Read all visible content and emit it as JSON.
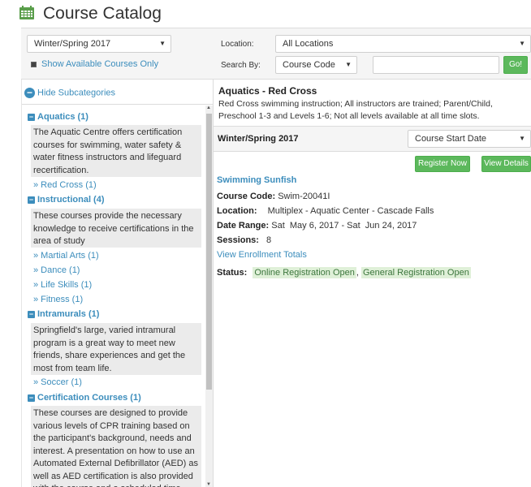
{
  "header": {
    "title": "Course Catalog",
    "icon": "calendar-icon"
  },
  "filters": {
    "term": "Winter/Spring 2017",
    "location_label": "Location:",
    "location_value": "All Locations",
    "show_available_label": "Show Available Courses Only",
    "show_available_checked": true,
    "search_by_label": "Search By:",
    "search_by_value": "Course Code",
    "search_text": "",
    "go_label": "Go!"
  },
  "sidebar": {
    "hide_sub_label": "Hide Subcategories",
    "categories": [
      {
        "head": "Aquatics (1)",
        "desc": "The Aquatic Centre offers certification courses for swimming, water safety & water fitness instructors and lifeguard recertification.",
        "subs": [
          "» Red Cross (1)"
        ]
      },
      {
        "head": "Instructional (4)",
        "desc": "These courses provide the necessary knowledge to receive certifications in the area of study",
        "subs": [
          "» Martial Arts (1)",
          "» Dance (1)",
          "» Life Skills (1)",
          "» Fitness (1)"
        ]
      },
      {
        "head": "Intramurals (1)",
        "desc": "Springfield's large, varied intramural program is a great way to meet new friends, share experiences and get the most from team life.",
        "subs": [
          "» Soccer (1)"
        ]
      },
      {
        "head": "Certification Courses (1)",
        "desc": "These courses are designed to provide various levels of CPR training based on the participant's background, needs and interest. A presentation on how to use an Automated External Defibrillator (AED) as well as AED certification is also provided with the course and a scheduled time with",
        "subs": []
      }
    ]
  },
  "main": {
    "category_title": "Aquatics - Red Cross",
    "category_desc": "Red Cross swimming instruction; All instructors are trained; Parent/Child, Preschool 1-3 and Levels 1-6; Not all levels available at all time slots.",
    "term": "Winter/Spring 2017",
    "sort_value": "Course Start Date",
    "register_label": "Register Now",
    "details_label": "View Details",
    "course": {
      "name": "Swimming Sunfish",
      "code_label": "Course Code:",
      "code": "Swim-20041I",
      "location_label": "Location:",
      "location": "Multiplex - Aquatic Center - Cascade Falls",
      "date_label": "Date Range:",
      "date": "Sat  May 6, 2017 - Sat  Jun 24, 2017",
      "sessions_label": "Sessions:",
      "sessions": "8",
      "enroll_link": "View Enrollment Totals",
      "status_label": "Status:",
      "status_1": "Online Registration Open",
      "status_sep": ",",
      "status_2": "General Registration Open"
    }
  },
  "colors": {
    "link": "#3c8dbc",
    "button_green": "#5cb85c",
    "calendar_icon": "#5a9e4b",
    "status_bg": "#dff0d8"
  }
}
